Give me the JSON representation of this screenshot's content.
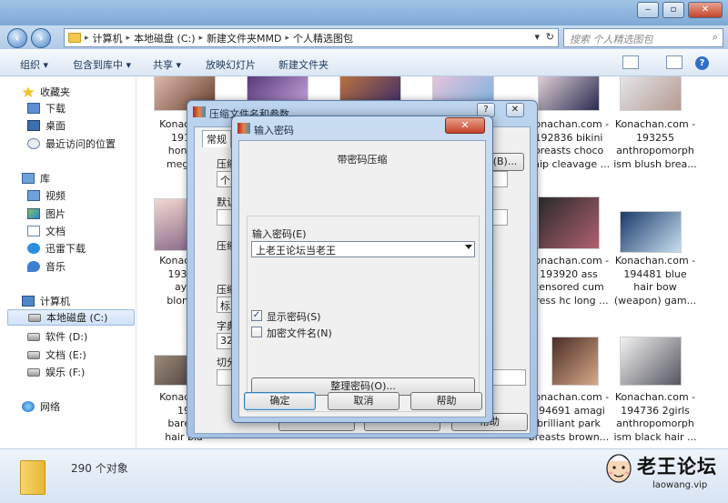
{
  "window": {
    "title": ""
  },
  "nav": {
    "path": [
      "计算机",
      "本地磁盘 (C:)",
      "新建文件夹MMD",
      "个人精选图包"
    ],
    "search_placeholder": "搜索 个人精选图包"
  },
  "toolbar": {
    "items": [
      "组织",
      "包含到库中",
      "共享",
      "放映幻灯片",
      "新建文件夹"
    ]
  },
  "sidebar": {
    "items": [
      {
        "label": "收藏夹",
        "icon": "star-icon"
      },
      {
        "label": "下载",
        "icon": "download-folder-icon"
      },
      {
        "label": "桌面",
        "icon": "desktop-icon"
      },
      {
        "label": "最近访问的位置",
        "icon": "recent-places-icon"
      },
      {
        "label": "库",
        "icon": "library-icon"
      },
      {
        "label": "视频",
        "icon": "video-library-icon"
      },
      {
        "label": "图片",
        "icon": "pictures-library-icon"
      },
      {
        "label": "文档",
        "icon": "documents-library-icon"
      },
      {
        "label": "迅雷下载",
        "icon": "thunder-download-icon"
      },
      {
        "label": "音乐",
        "icon": "music-library-icon"
      },
      {
        "label": "计算机",
        "icon": "computer-icon"
      },
      {
        "label": "本地磁盘 (C:)",
        "icon": "drive-icon"
      },
      {
        "label": "软件 (D:)",
        "icon": "drive-icon"
      },
      {
        "label": "文档 (E:)",
        "icon": "drive-icon"
      },
      {
        "label": "娱乐 (F:)",
        "icon": "drive-icon"
      },
      {
        "label": "网络",
        "icon": "network-icon"
      }
    ]
  },
  "files": [
    {
      "lines": [
        "Konachan",
        "1918",
        "honda",
        "megan"
      ]
    },
    {
      "lines": [
        "",
        "",
        "",
        ""
      ]
    },
    {
      "lines": [
        "",
        "",
        "",
        ""
      ]
    },
    {
      "lines": [
        "",
        "",
        "",
        ""
      ]
    },
    {
      "lines": [
        "Konachan.com -",
        "192836 bikini",
        "breasts choco",
        "chip cleavage ..."
      ]
    },
    {
      "lines": [
        "Konachan.com -",
        "193255",
        "anthropomorph",
        "ism blush brea..."
      ]
    },
    {
      "lines": [
        "Konachan",
        "19333",
        "aya",
        "blonde"
      ]
    },
    {
      "lines": [
        "Konachan.com -",
        "193920 ass",
        "censored cum",
        "dress hc long ..."
      ]
    },
    {
      "lines": [
        "Konachan.com -",
        "194481 blue",
        "hair bow",
        "(weapon) gam..."
      ]
    },
    {
      "lines": [
        "Konachan",
        "19",
        "barefo",
        "hair bla"
      ]
    },
    {
      "lines": [
        "Konachan.com -",
        "194691 amagi",
        "brilliant park",
        "breasts brown..."
      ]
    },
    {
      "lines": [
        "Konachan.com -",
        "194736 2girls",
        "anthropomorph",
        "ism black hair ..."
      ]
    }
  ],
  "status": {
    "count": "290 个对象"
  },
  "watermark": {
    "name": "老王论坛",
    "url": "laowang.vip"
  },
  "back_dialog": {
    "title": "压缩文件名和参数",
    "help_glyph": "?",
    "close_glyph": "✕",
    "tab": "常规",
    "labels": [
      "压缩",
      "默认",
      "压缩",
      "压缩",
      "字典",
      "切分"
    ],
    "field_values": [
      "个人",
      "标准",
      "32 M"
    ],
    "buttons": [
      "(B)...",
      "帮助"
    ]
  },
  "dialog": {
    "title": "输入密码",
    "heading": "带密码压缩",
    "password_label": "输入密码(E)",
    "password_value": "上老王论坛当老王",
    "show_password_label": "显示密码(S)",
    "show_password_checked": true,
    "encrypt_names_label": "加密文件名(N)",
    "encrypt_names_checked": false,
    "organize_button": "整理密码(O)...",
    "ok_button": "确定",
    "cancel_button": "取消",
    "help_button": "帮助",
    "close_glyph": "✕",
    "check_glyph": "✓"
  }
}
